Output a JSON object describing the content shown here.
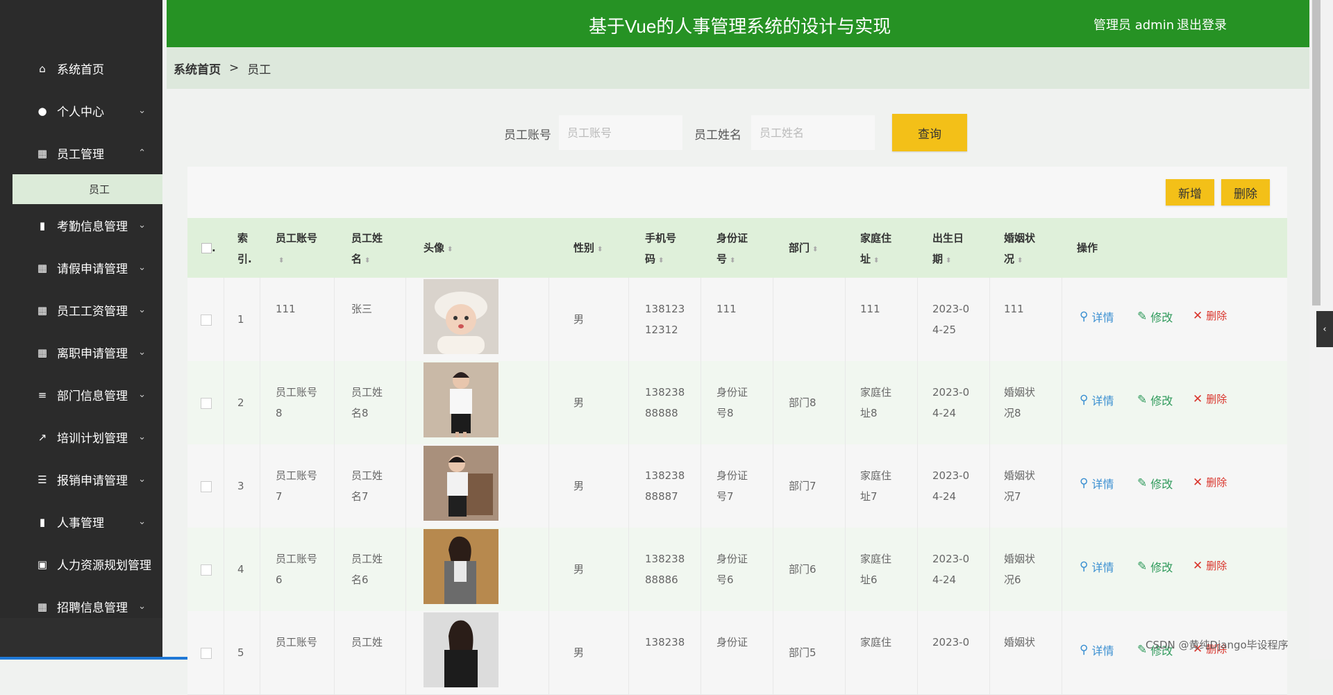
{
  "header": {
    "title": "基于Vue的人事管理系统的设计与实现",
    "user": "管理员 admin",
    "logout": "退出登录"
  },
  "sidebar": {
    "items": [
      {
        "label": "系统首页",
        "icon": "home-icon",
        "glyph": "⌂",
        "chevron": ""
      },
      {
        "label": "个人中心",
        "icon": "user-icon",
        "glyph": "●",
        "chevron": "⌄"
      },
      {
        "label": "员工管理",
        "icon": "grid-icon",
        "glyph": "▦",
        "chevron": "⌃"
      },
      {
        "label": "考勤信息管理",
        "icon": "book-icon",
        "glyph": "▮",
        "chevron": "⌄"
      },
      {
        "label": "请假申请管理",
        "icon": "grid-icon",
        "glyph": "▦",
        "chevron": "⌄"
      },
      {
        "label": "员工工资管理",
        "icon": "grid-icon",
        "glyph": "▦",
        "chevron": "⌄"
      },
      {
        "label": "离职申请管理",
        "icon": "grid-icon",
        "glyph": "▦",
        "chevron": "⌄"
      },
      {
        "label": "部门信息管理",
        "icon": "list-icon",
        "glyph": "≡",
        "chevron": "⌄"
      },
      {
        "label": "培训计划管理",
        "icon": "line-chart-icon",
        "glyph": "↗",
        "chevron": "⌄"
      },
      {
        "label": "报销申请管理",
        "icon": "sliders-icon",
        "glyph": "☰",
        "chevron": "⌄"
      },
      {
        "label": "人事管理",
        "icon": "bar-chart-icon",
        "glyph": "▮",
        "chevron": "⌄"
      },
      {
        "label": "人力资源规划管理",
        "icon": "clipboard-icon",
        "glyph": "▣",
        "chevron": ""
      },
      {
        "label": "招聘信息管理",
        "icon": "grid-icon",
        "glyph": "▦",
        "chevron": "⌄"
      }
    ],
    "sub_item": "员工"
  },
  "breadcrumb": {
    "home": "系统首页",
    "sep": ">",
    "current": "员工"
  },
  "search": {
    "account_label": "员工账号",
    "account_placeholder": "员工账号",
    "name_label": "员工姓名",
    "name_placeholder": "员工姓名",
    "query_button": "查询"
  },
  "toolbar": {
    "add": "新增",
    "delete": "删除"
  },
  "table": {
    "headers": {
      "check": ".",
      "index": [
        "索",
        "引."
      ],
      "account": [
        "员工账号",
        ""
      ],
      "name": [
        "员工姓",
        "名"
      ],
      "avatar": "头像",
      "gender": "性别",
      "phone": [
        "手机号",
        "码"
      ],
      "idcard": [
        "身份证",
        "号"
      ],
      "dept": "部门",
      "address": [
        "家庭住",
        "址"
      ],
      "birth": [
        "出生日",
        "期"
      ],
      "marital": [
        "婚姻状",
        "况"
      ],
      "ops": "操作"
    },
    "actions": {
      "detail": "详情",
      "edit": "修改",
      "delete": "删除"
    },
    "rows": [
      {
        "index": "1",
        "account": [
          "111",
          ""
        ],
        "name": [
          "张三",
          ""
        ],
        "gender": "男",
        "phone": [
          "138123",
          "12312"
        ],
        "idcard": [
          "111",
          ""
        ],
        "dept": "",
        "address": [
          "111",
          ""
        ],
        "birth": [
          "2023-0",
          "4-25"
        ],
        "marital": [
          "111",
          ""
        ]
      },
      {
        "index": "2",
        "account": [
          "员工账号",
          "8"
        ],
        "name": [
          "员工姓",
          "名8"
        ],
        "gender": "男",
        "phone": [
          "138238",
          "88888"
        ],
        "idcard": [
          "身份证",
          "号8"
        ],
        "dept": "部门8",
        "address": [
          "家庭住",
          "址8"
        ],
        "birth": [
          "2023-0",
          "4-24"
        ],
        "marital": [
          "婚姻状",
          "况8"
        ]
      },
      {
        "index": "3",
        "account": [
          "员工账号",
          "7"
        ],
        "name": [
          "员工姓",
          "名7"
        ],
        "gender": "男",
        "phone": [
          "138238",
          "88887"
        ],
        "idcard": [
          "身份证",
          "号7"
        ],
        "dept": "部门7",
        "address": [
          "家庭住",
          "址7"
        ],
        "birth": [
          "2023-0",
          "4-24"
        ],
        "marital": [
          "婚姻状",
          "况7"
        ]
      },
      {
        "index": "4",
        "account": [
          "员工账号",
          "6"
        ],
        "name": [
          "员工姓",
          "名6"
        ],
        "gender": "男",
        "phone": [
          "138238",
          "88886"
        ],
        "idcard": [
          "身份证",
          "号6"
        ],
        "dept": "部门6",
        "address": [
          "家庭住",
          "址6"
        ],
        "birth": [
          "2023-0",
          "4-24"
        ],
        "marital": [
          "婚姻状",
          "况6"
        ]
      },
      {
        "index": "5",
        "account": [
          "员工账号",
          ""
        ],
        "name": [
          "员工姓",
          ""
        ],
        "gender": "男",
        "phone": [
          "138238",
          ""
        ],
        "idcard": [
          "身份证",
          ""
        ],
        "dept": "部门5",
        "address": [
          "家庭住",
          ""
        ],
        "birth": [
          "2023-0",
          ""
        ],
        "marital": [
          "婚姻状",
          ""
        ]
      }
    ]
  },
  "watermark": "CSDN @黄纯Django毕设程序",
  "colors": {
    "header": "#269224",
    "sidebar": "#2b2b2b",
    "accent_button": "#f3c018",
    "table_head": "#dff0da"
  }
}
